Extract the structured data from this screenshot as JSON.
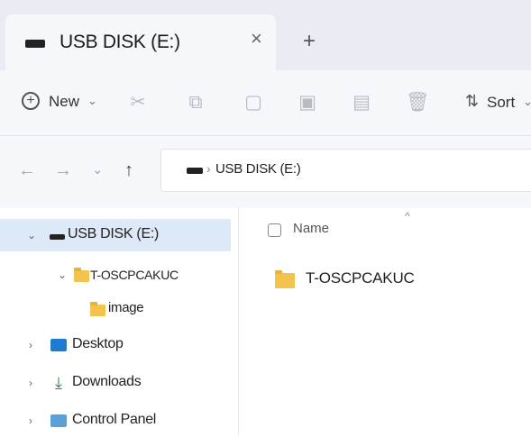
{
  "tab": {
    "title": "USB DISK (E:)",
    "close_glyph": "×",
    "new_tab_glyph": "+"
  },
  "command_bar": {
    "new_label": "New",
    "new_caret": "⌄",
    "sort_label": "Sort",
    "sort_caret": "⌄",
    "icons": [
      "cut-icon",
      "copy-icon",
      "paste-icon",
      "rename-icon",
      "share-icon",
      "delete-icon"
    ]
  },
  "navigation": {
    "back": "←",
    "forward": "→",
    "recent": "⌄",
    "up": "↑"
  },
  "address": {
    "separator": "›",
    "path": "USB DISK (E:)"
  },
  "sidebar": {
    "items": [
      {
        "label": "USB DISK (E:)",
        "chevron": "⌄",
        "icon": "drive-icon",
        "selected": true
      },
      {
        "label": "T-OSCPCAKUC",
        "chevron": "⌄",
        "icon": "folder-icon"
      },
      {
        "label": "image",
        "chevron": "",
        "icon": "folder-icon"
      },
      {
        "label": "Desktop",
        "chevron": "›",
        "icon": "desktop-icon"
      },
      {
        "label": "Downloads",
        "chevron": "›",
        "icon": "download-icon"
      },
      {
        "label": "Control Panel",
        "chevron": "›",
        "icon": "control-panel-icon"
      }
    ]
  },
  "content": {
    "column_name": "Name",
    "sort_indicator": "^",
    "files": [
      {
        "name": "T-OSCPCAKUC",
        "icon": "folder-icon"
      }
    ]
  },
  "colors": {
    "accent_selected": "#dde9f6",
    "folder": "#f2c44d",
    "tabbar_bg": "#e9edf3",
    "toolbar_bg": "#f5f7fa"
  }
}
